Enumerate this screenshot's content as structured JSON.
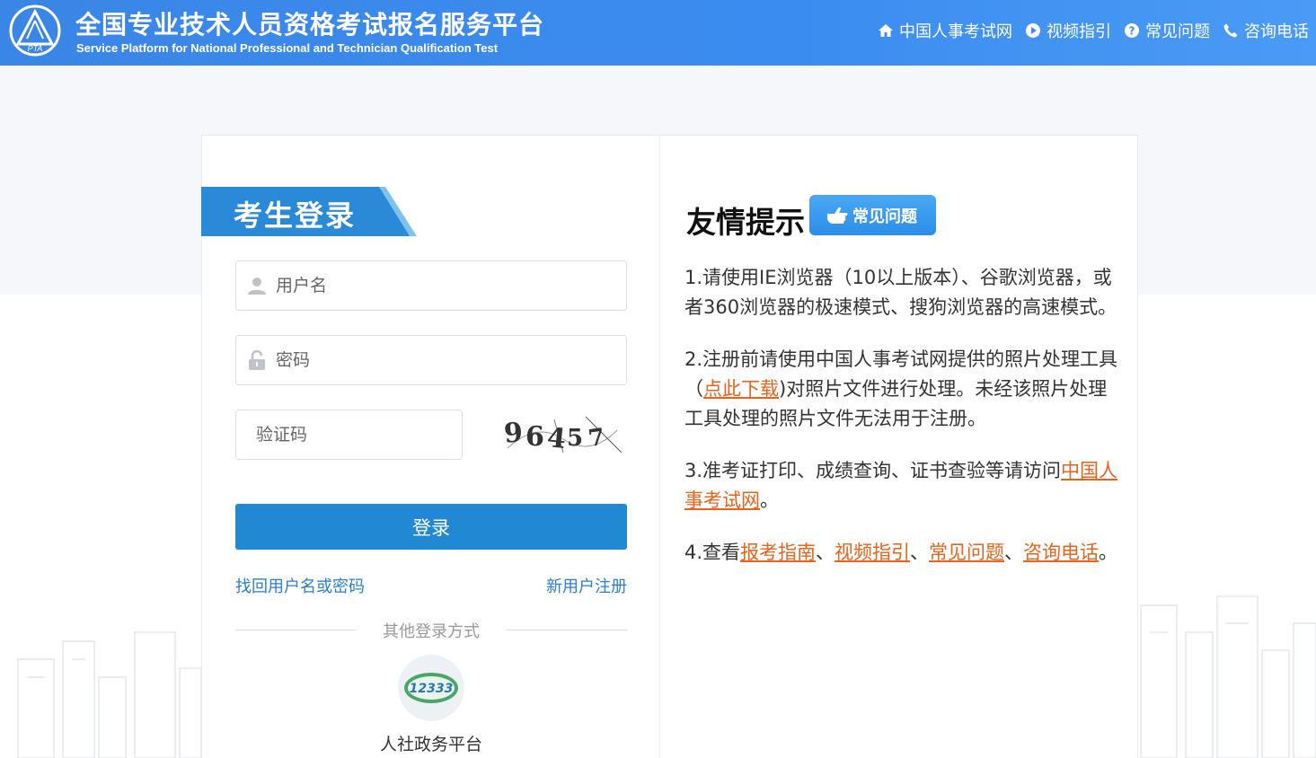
{
  "header": {
    "logo_text": "PTA",
    "title": "全国专业技术人员资格考试报名服务平台",
    "subtitle": "Service Platform for National Professional and Technician Qualification Test",
    "nav": [
      {
        "label": "中国人事考试网",
        "icon": "home-icon"
      },
      {
        "label": "视频指引",
        "icon": "play-icon"
      },
      {
        "label": "常见问题",
        "icon": "question-icon"
      },
      {
        "label": "咨询电话",
        "icon": "phone-icon"
      }
    ]
  },
  "login": {
    "tab_title": "考生登录",
    "username_placeholder": "用户名",
    "password_placeholder": "密码",
    "captcha_placeholder": "验证码",
    "captcha_text": [
      "9",
      "6",
      "4",
      "5",
      "7"
    ],
    "submit_label": "登录",
    "forgot_link": "找回用户名或密码",
    "register_link": "新用户注册",
    "other_methods_label": "其他登录方式",
    "alt_login_logo": "12333",
    "alt_login_label": "人社政务平台"
  },
  "tips": {
    "title": "友情提示",
    "faq_badge": "常见问题",
    "items": {
      "t1": "1.请使用IE浏览器（10以上版本）、谷歌浏览器，或者360浏览器的极速模式、搜狗浏览器的高速模式。",
      "t2_a": "2.注册前请使用中国人事考试网提供的照片处理工具（",
      "t2_link": "点此下载",
      "t2_b": ")对照片文件进行处理。未经该照片处理工具处理的照片文件无法用于注册。",
      "t3_a": "3.准考证打印、成绩查询、证书查验等请访问",
      "t3_link": "中国人事考试网",
      "t3_b": "。",
      "t4_a": "4.查看",
      "t4_link1": "报考指南",
      "t4_sep1": "、",
      "t4_link2": "视频指引",
      "t4_sep2": "、",
      "t4_link3": "常见问题",
      "t4_sep3": "、",
      "t4_link4": "咨询电话",
      "t4_b": "。"
    }
  },
  "colors": {
    "header_bg": "#3b8cf0",
    "primary_button": "#2189d4",
    "link_blue": "#2a7fd0",
    "link_orange": "#e8621a"
  }
}
